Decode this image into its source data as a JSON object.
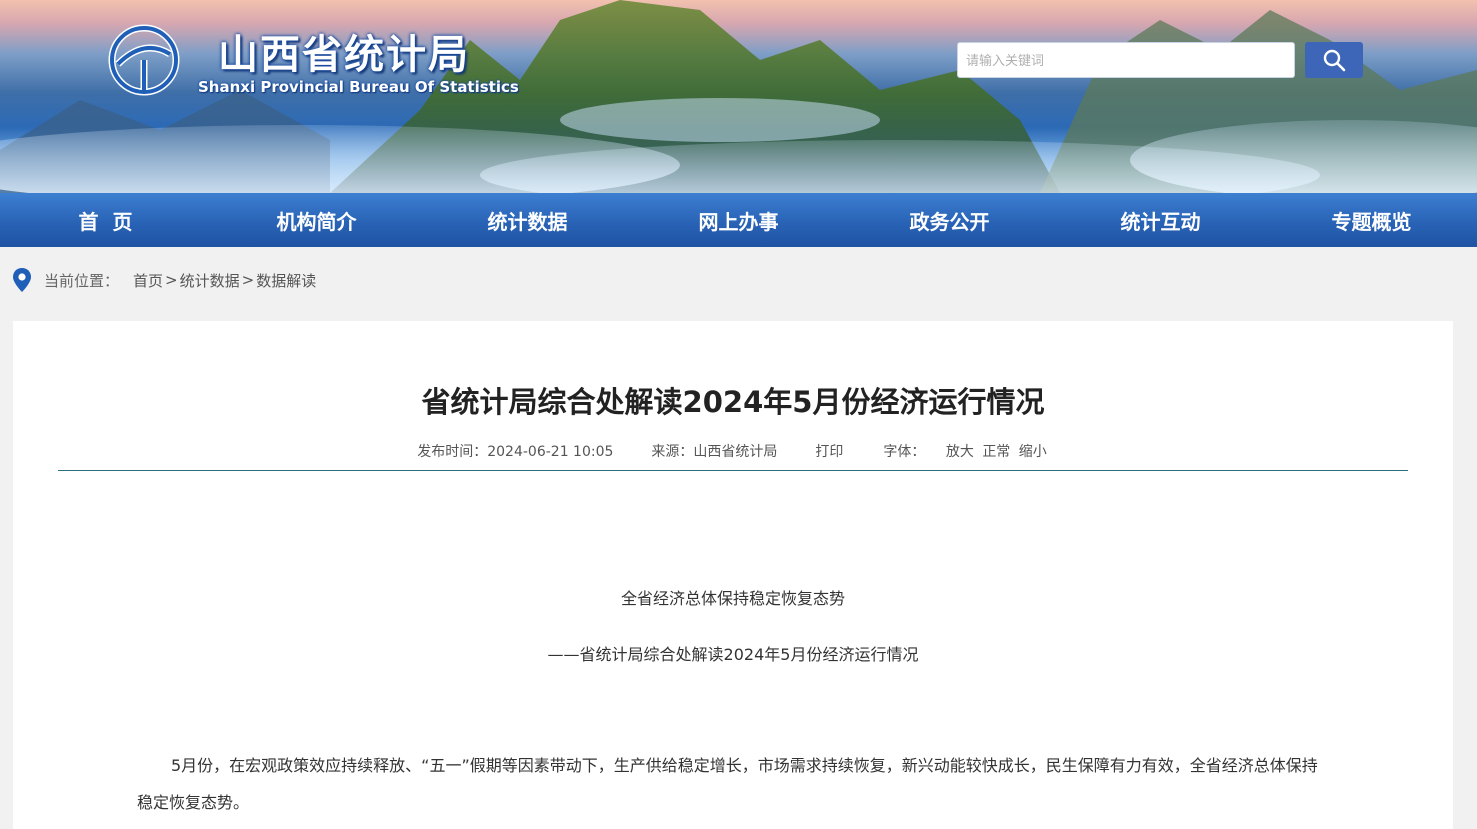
{
  "header": {
    "title": "山西省统计局",
    "subtitle": "Shanxi Provincial Bureau Of Statistics",
    "search_placeholder": "请输入关键词"
  },
  "nav": {
    "items": [
      {
        "label": "首  页"
      },
      {
        "label": "机构简介"
      },
      {
        "label": "统计数据"
      },
      {
        "label": "网上办事"
      },
      {
        "label": "政务公开"
      },
      {
        "label": "统计互动"
      },
      {
        "label": "专题概览"
      }
    ]
  },
  "breadcrumb": {
    "label": "当前位置：",
    "items": [
      "首页",
      "统计数据",
      "数据解读"
    ],
    "separator": ">"
  },
  "article": {
    "title": "省统计局综合处解读2024年5月份经济运行情况",
    "publish_time": "发布时间：2024-06-21 10:05",
    "source": "来源：山西省统计局",
    "print": "打印",
    "font_label": "字体：",
    "font_large": "放大",
    "font_normal": "正常",
    "font_small": "缩小",
    "headline": "全省经济总体保持稳定恢复态势",
    "subheadline": "——省统计局综合处解读2024年5月份经济运行情况",
    "paragraph": "5月份，在宏观政策效应持续释放、“五一”假期等因素带动下，生产供给稳定增长，市场需求持续恢复，新兴动能较快成长，民生保障有力有效，全省经济总体保持稳定恢复态势。"
  },
  "colors": {
    "nav_bg": "#2963b6",
    "search_button": "#3e66b8",
    "divider": "#2a6f7e"
  }
}
